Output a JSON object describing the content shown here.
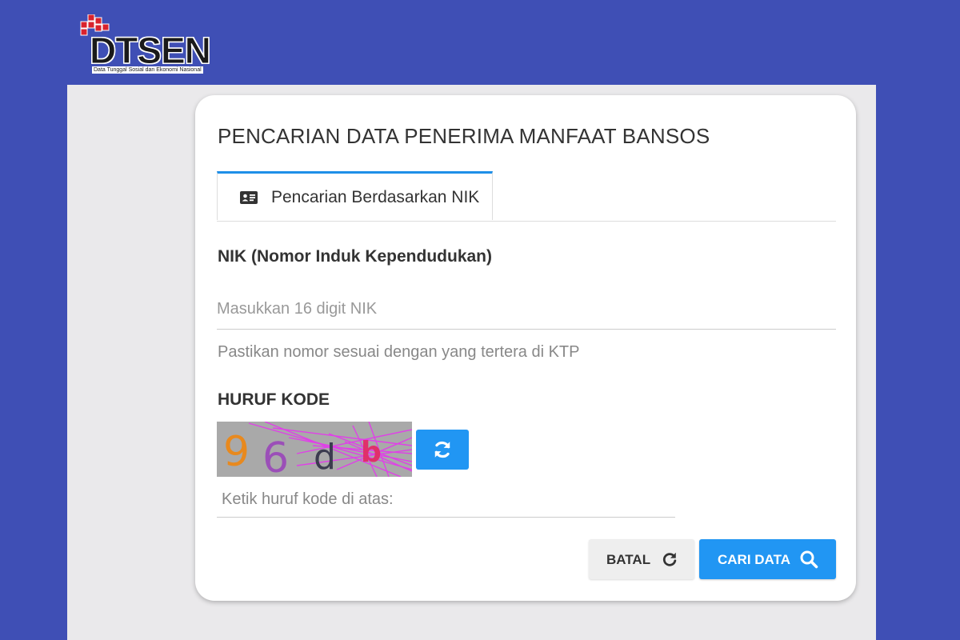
{
  "header": {
    "logo_text": "DTSEN",
    "logo_subtitle": "Data Tunggal Sosial dan Ekonomi Nasional"
  },
  "card": {
    "title": "PENCARIAN DATA PENERIMA MANFAAT BANSOS",
    "tab": {
      "label": "Pencarian Berdasarkan NIK",
      "icon": "id-card-icon"
    },
    "nik": {
      "label": "NIK (Nomor Induk Kependudukan)",
      "placeholder": "Masukkan 16 digit NIK",
      "value": "",
      "hint": "Pastikan nomor sesuai dengan yang tertera di KTP"
    },
    "captcha": {
      "label": "HURUF KODE",
      "characters": [
        "9",
        "6",
        "d",
        "b"
      ],
      "char_colors": [
        "#e8891e",
        "#9b4fb8",
        "#3b3b4f",
        "#e0306a"
      ],
      "line_color": "#e040e8",
      "refresh_icon": "refresh-icon",
      "input_placeholder": "Ketik huruf kode di atas:",
      "input_value": ""
    },
    "buttons": {
      "cancel_label": "BATAL",
      "cancel_icon": "reset-icon",
      "submit_label": "CARI DATA",
      "submit_icon": "search-icon"
    }
  },
  "colors": {
    "background": "#3f4fb5",
    "panel": "#eae9eb",
    "accent": "#2196f3",
    "tab_border": "#1e8fe8",
    "logo_red": "#d9232d"
  }
}
